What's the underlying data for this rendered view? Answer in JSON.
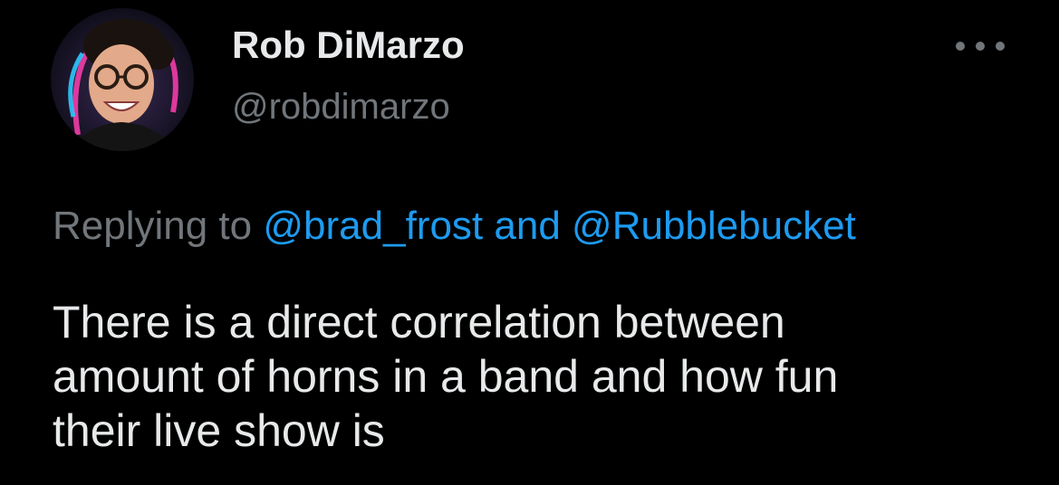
{
  "tweet": {
    "author_name": "Rob DiMarzo",
    "author_handle": "@robdimarzo",
    "more_icon": "ellipsis-icon",
    "reply": {
      "prefix": "Replying to",
      "mention_1": "@brad_frost",
      "conjunction": "and",
      "mention_2": "@Rubblebucket"
    },
    "text_lines": [
      "There is a direct correlation between",
      "amount of horns in a band and how fun",
      "their live show is"
    ]
  },
  "colors": {
    "background": "#000000",
    "primary_text": "#e7e9ea",
    "secondary_text": "#71767b",
    "link": "#1d9bf0"
  }
}
